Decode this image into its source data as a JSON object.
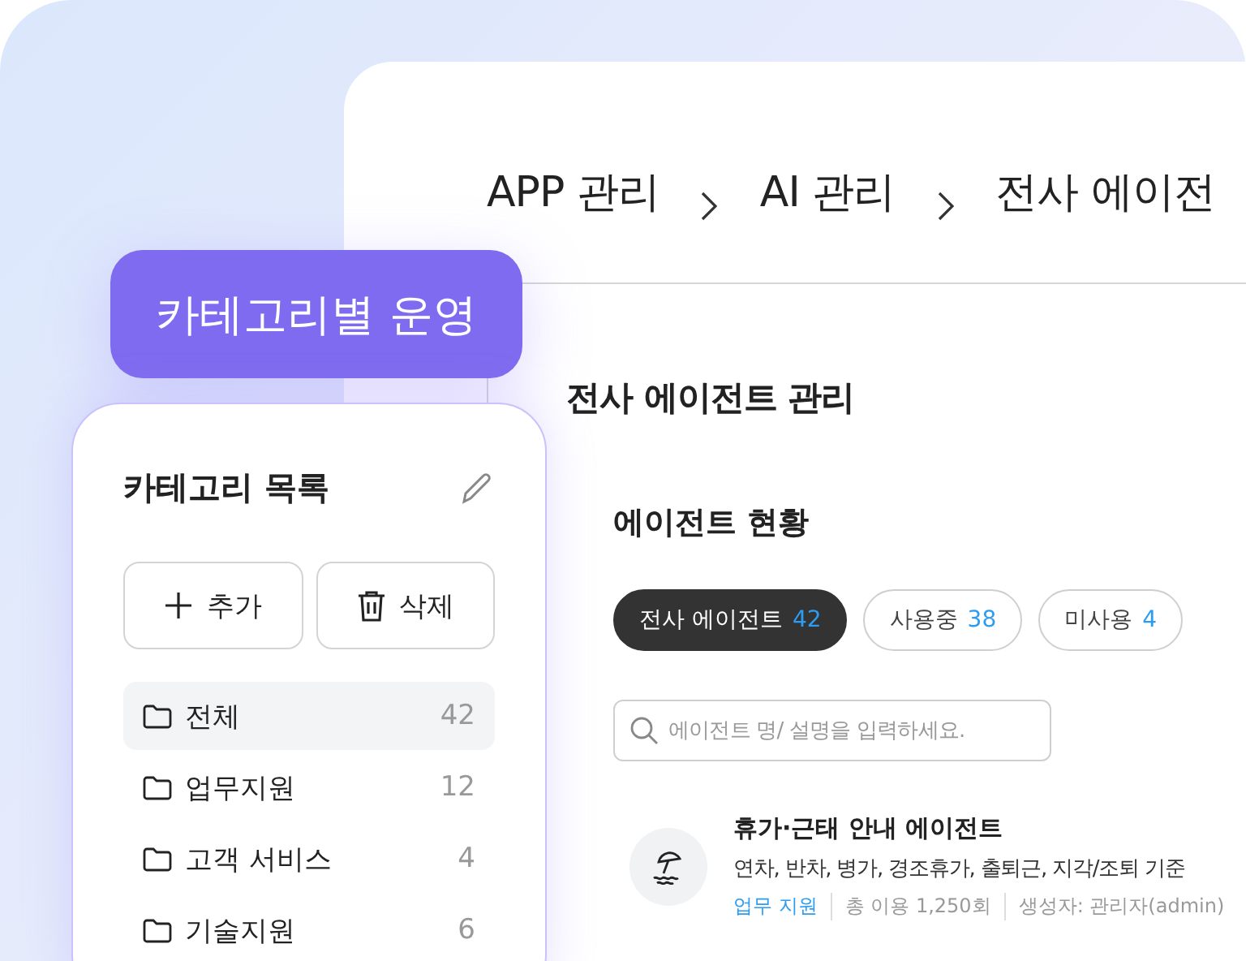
{
  "breadcrumb": [
    "APP 관리",
    "AI 관리",
    "전사 에이전"
  ],
  "badge": "카테고리별 운영",
  "category_panel": {
    "title": "카테고리 목록",
    "buttons": [
      {
        "kind": "add",
        "label": "추가"
      },
      {
        "kind": "delete",
        "label": "삭제"
      }
    ],
    "items": [
      {
        "label": "전체",
        "count": "42",
        "selected": true
      },
      {
        "label": "업무지원",
        "count": "12",
        "selected": false
      },
      {
        "label": "고객 서비스",
        "count": "4",
        "selected": false
      },
      {
        "label": "기술지원",
        "count": "6",
        "selected": false
      }
    ]
  },
  "page_title": "전사 에이전트 관리",
  "section_title": "에이전트 현황",
  "filters": [
    {
      "label": "전사 에이전트",
      "count": "42",
      "selected": true
    },
    {
      "label": "사용중",
      "count": "38",
      "selected": false
    },
    {
      "label": "미사용",
      "count": "4",
      "selected": false
    }
  ],
  "search": {
    "placeholder": "에이전트 명/ 설명을 입력하세요."
  },
  "agents": [
    {
      "name": "휴가·근태 안내 에이전트",
      "description": "연차, 반차, 병가, 경조휴가, 출퇴근, 지각/조퇴 기준",
      "category": "업무 지원",
      "usage": "총 이용 1,250회",
      "creator": "생성자: 관리자(admin)"
    }
  ]
}
